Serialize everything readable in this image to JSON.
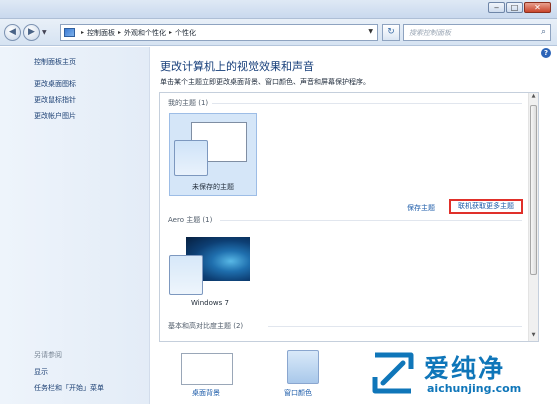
{
  "window": {
    "controls": {
      "minimize": "‒",
      "maximize": "□",
      "close": "✕"
    }
  },
  "nav": {
    "back": "◀",
    "forward": "▶",
    "dropdown": "▼",
    "breadcrumb": [
      "控制面板",
      "外观和个性化",
      "个性化"
    ],
    "separator": "▸",
    "address_dropdown": "▼",
    "refresh": "↻",
    "search_placeholder": "搜索控制面板",
    "search_icon": "⌕"
  },
  "sidebar": {
    "items": [
      {
        "label": "控制面板主页"
      },
      {
        "label": "更改桌面图标"
      },
      {
        "label": "更改鼠标指针"
      },
      {
        "label": "更改帐户图片"
      }
    ],
    "see_also": "另请参阅",
    "see_also_items": [
      {
        "label": "显示"
      },
      {
        "label": "任务栏和「开始」菜单"
      }
    ]
  },
  "main": {
    "help": "?",
    "title": "更改计算机上的视觉效果和声音",
    "description": "单击某个主题立即更改桌面背景、窗口颜色、声音和屏幕保护程序。",
    "groups": {
      "my_themes": "我的主题 (1)",
      "aero_themes": "Aero 主题 (1)",
      "basic_themes": "基本和高对比度主题 (2)"
    },
    "themes": {
      "unsaved": "未保存的主题",
      "windows7": "Windows 7"
    },
    "save_theme": "保存主题",
    "get_more_online": "联机获取更多主题",
    "scroll": {
      "up": "▲",
      "down": "▼"
    }
  },
  "bottom": {
    "desktop_background": "桌面背景",
    "window_color": "窗口颜色"
  },
  "watermark": {
    "cn": "爱纯净",
    "url": "aichunjing.com"
  },
  "colors": {
    "link": "#1a5aa8",
    "highlight_border": "#e0302a",
    "watermark": "#0f76b9"
  }
}
